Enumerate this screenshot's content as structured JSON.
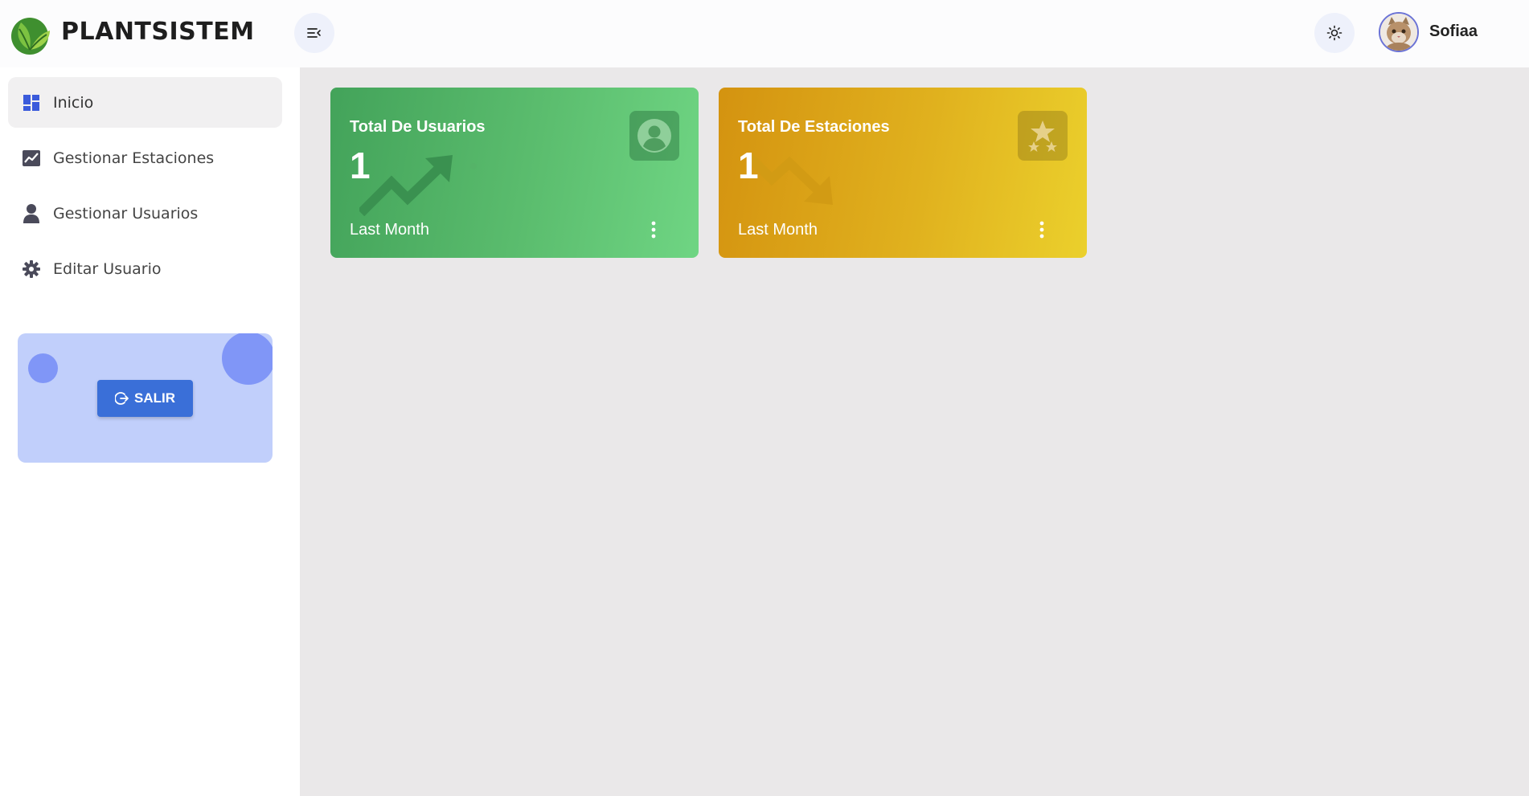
{
  "header": {
    "brand": "PLANTSISTEM",
    "username": "Sofiaa"
  },
  "sidebar": {
    "items": [
      {
        "label": "Inicio",
        "icon": "dashboard-icon",
        "active": true
      },
      {
        "label": "Gestionar Estaciones",
        "icon": "chart-line-icon",
        "active": false
      },
      {
        "label": "Gestionar Usuarios",
        "icon": "user-icon",
        "active": false
      },
      {
        "label": "Editar Usuario",
        "icon": "gear-icon",
        "active": false
      }
    ],
    "logout_label": "SALIR"
  },
  "cards": [
    {
      "title": "Total De Usuarios",
      "value": "1",
      "footer": "Last Month",
      "color": "#4caf5c",
      "icon": "user-circle-icon",
      "trend": "up"
    },
    {
      "title": "Total De Estaciones",
      "value": "1",
      "footer": "Last Month",
      "color": "#e0b11e",
      "icon": "stars-icon",
      "trend": "down"
    }
  ],
  "colors": {
    "accent": "#3a6fd8",
    "sidebar_active": "#f1f0f1",
    "main_bg": "#eae8e9",
    "logout_card": "#c1cffb"
  }
}
